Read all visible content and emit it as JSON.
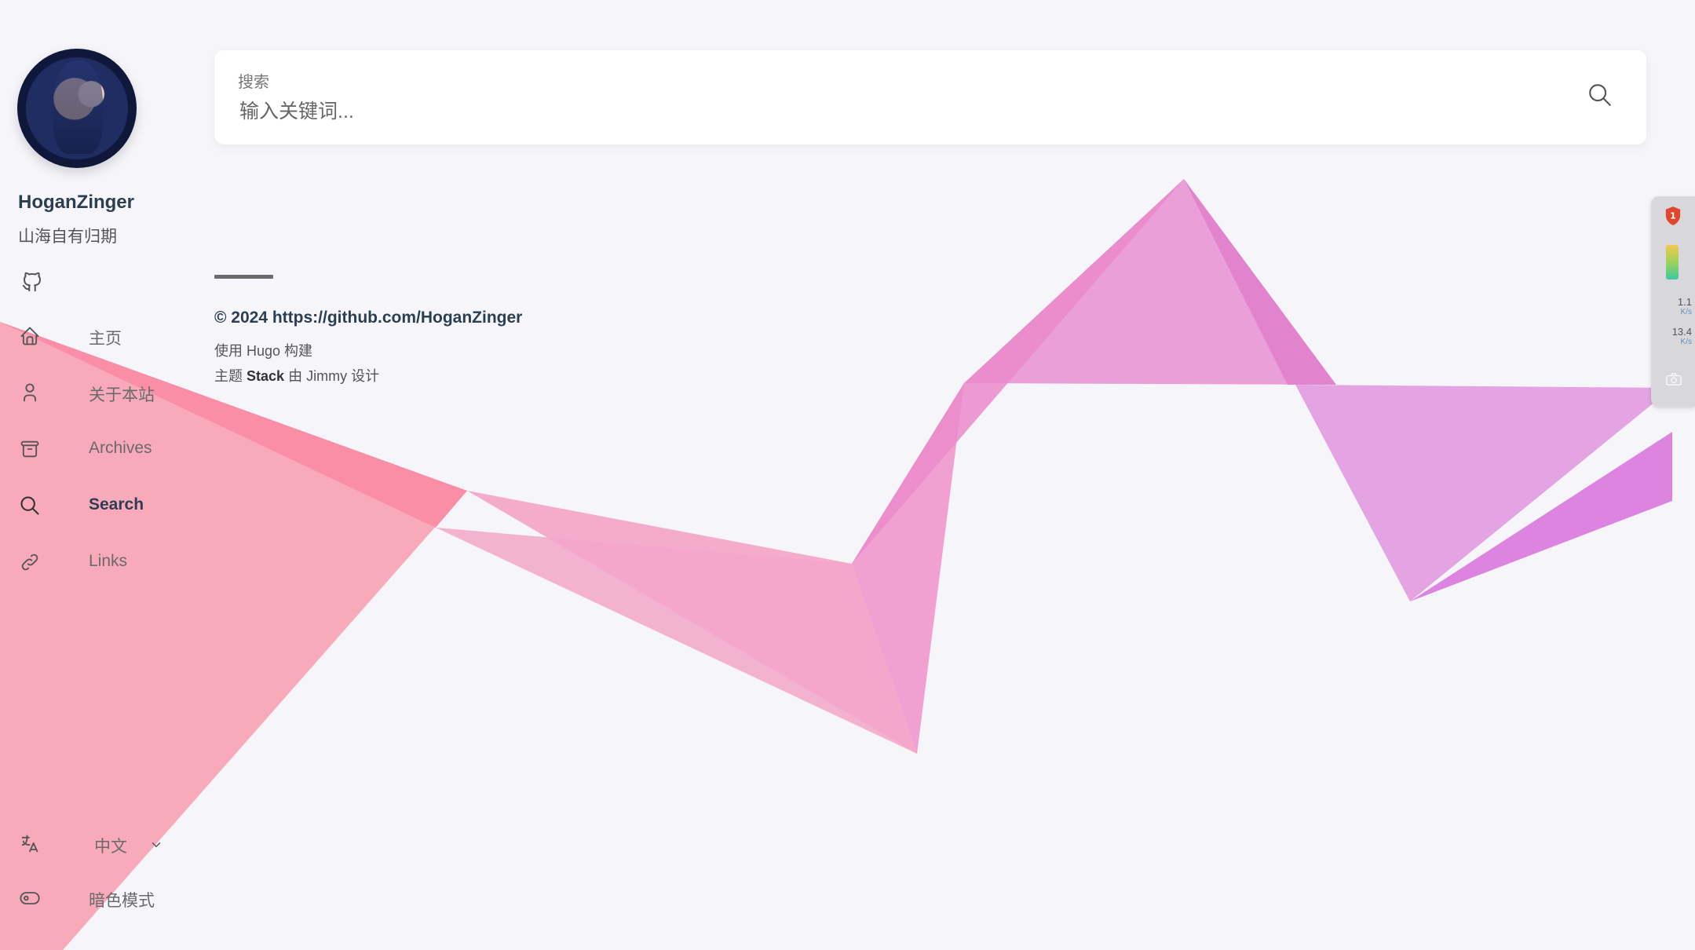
{
  "site": {
    "name": "HoganZinger",
    "description": "山海自有归期"
  },
  "menu": {
    "items": [
      {
        "label": "主页",
        "icon": "home-icon"
      },
      {
        "label": "关于本站",
        "icon": "user-icon"
      },
      {
        "label": "Archives",
        "icon": "archive-icon"
      },
      {
        "label": "Search",
        "icon": "search-icon",
        "active": true
      },
      {
        "label": "Links",
        "icon": "link-icon"
      }
    ],
    "language": "中文",
    "dark_mode": "暗色模式"
  },
  "search": {
    "label": "搜索",
    "placeholder": "输入关键词..."
  },
  "footer": {
    "copyright": "© 2024 https://github.com/HoganZinger",
    "powered_prefix": "使用 Hugo 构建",
    "theme_prefix": "主题",
    "theme_name": "Stack",
    "theme_suffix": "由 Jimmy 设计"
  },
  "widget": {
    "badge": "1",
    "upload": "1.1",
    "upload_unit": "K/s",
    "download": "13.4",
    "download_unit": "K/s"
  },
  "colors": {
    "ribbon_pink": "#f48aa6",
    "ribbon_magenta": "#e07ad0",
    "text_dark": "#2c3e50"
  }
}
